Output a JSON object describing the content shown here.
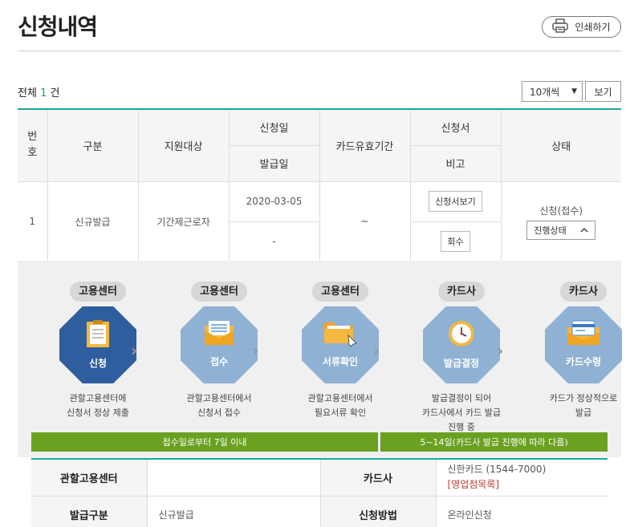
{
  "header": {
    "title": "신청내역",
    "print_label": "인쇄하기"
  },
  "list_controls": {
    "total_prefix": "전체",
    "total_count": "1",
    "total_suffix": "건",
    "per_page_value": "10개씩",
    "view_label": "보기"
  },
  "table": {
    "headers": {
      "no": "번호",
      "category": "구분",
      "target": "지원대상",
      "apply_date": "신청일",
      "issue_date": "발급일",
      "card_period": "카드유효기간",
      "application": "신청서",
      "note": "비고",
      "status": "상태"
    },
    "rows": [
      {
        "no": "1",
        "category": "신규발급",
        "target": "기간제근로자",
        "apply_date": "2020-03-05",
        "issue_date": "-",
        "card_period": "~",
        "view_button": "신청서보기",
        "cancel_button": "회수",
        "status": "신청(접수)",
        "status_toggle": "진행상태"
      }
    ]
  },
  "process": {
    "steps": [
      {
        "tag": "고용센터",
        "label": "신청",
        "desc1": "관할고용센터에",
        "desc2": "신청서 정상 제출",
        "desc3": ""
      },
      {
        "tag": "고용센터",
        "label": "접수",
        "desc1": "관할고용센터에서",
        "desc2": "신청서 접수",
        "desc3": ""
      },
      {
        "tag": "고용센터",
        "label": "서류확인",
        "desc1": "관할고용센터에서",
        "desc2": "필요서류 확인",
        "desc3": ""
      },
      {
        "tag": "카드사",
        "label": "발급결정",
        "desc1": "발급결정이 되어",
        "desc2": "카드사에서 카드 발급",
        "desc3": "진행 중"
      },
      {
        "tag": "카드사",
        "label": "카드수령",
        "desc1": "카드가 정상적으로",
        "desc2": "발급",
        "desc3": ""
      }
    ],
    "bar_left": "접수일로부터 7일 이내",
    "bar_right": "5~14일(카드사 발급 진행에 따라 다름)",
    "colors": {
      "active": "#2f5e9e",
      "inactive": "#8fb1d3",
      "bar": "#6aa121"
    }
  },
  "detail": {
    "center_label": "관할고용센터",
    "center_value": "",
    "card_company_label": "카드사",
    "card_company_value": "신한카드 (1544-7000)",
    "card_company_link": "[영업점목록]",
    "issue_type_label": "발급구분",
    "issue_type_value": "신규발급",
    "method_label": "신청방법",
    "method_value": "온라인신청"
  }
}
